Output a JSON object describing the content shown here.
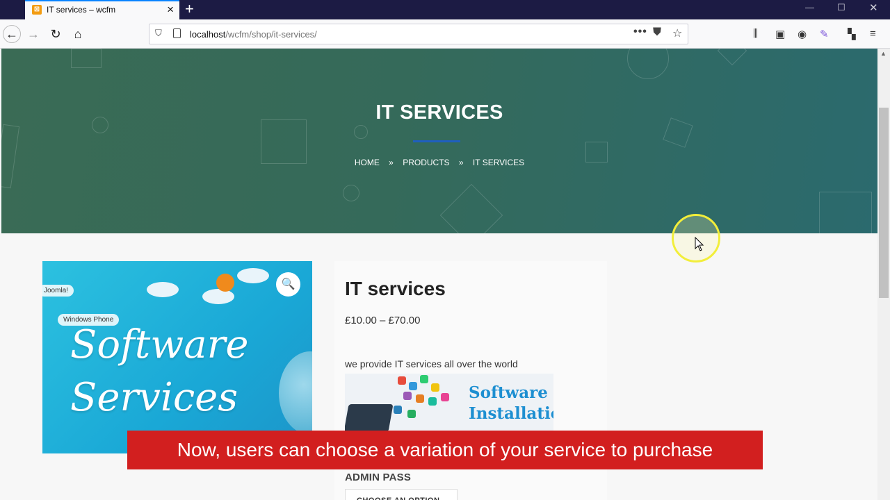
{
  "browser": {
    "tab_title": "IT services – wcfm",
    "url_host": "localhost",
    "url_path": "/wcfm/shop/it-services/"
  },
  "hero": {
    "title": "IT SERVICES",
    "breadcrumb": [
      "HOME",
      "PRODUCTS",
      "IT SERVICES"
    ],
    "breadcrumb_separator": "»"
  },
  "product": {
    "title": "IT services",
    "price": "£10.00 – £70.00",
    "description": "we provide IT services all over the world",
    "image_text_line1": "Software",
    "image_text_line2": "Services",
    "image_chip_1": "Joomla!",
    "image_chip_2": "Windows Phone",
    "banner_text_line1": "Software",
    "banner_text_line2": "Installatio",
    "attribute_label": "ADMIN PASS",
    "select_placeholder": "CHOOSE AN OPTION"
  },
  "caption": "Now, users can choose a variation of your service to purchase",
  "colors": {
    "hero_start": "#3a6b55",
    "hero_end": "#2b6a6e",
    "caption_bg": "#d21f1f",
    "accent_rule": "#1f5fbf"
  }
}
